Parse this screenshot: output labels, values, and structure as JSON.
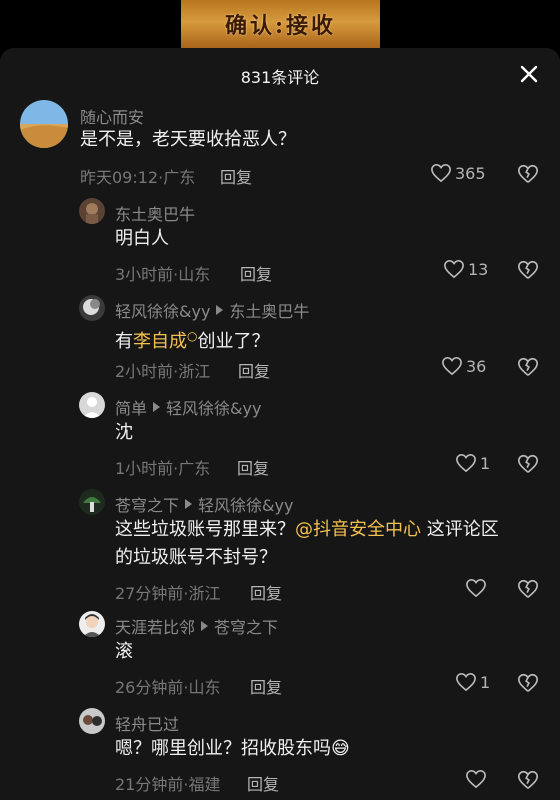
{
  "video": {
    "banner_text": "确认:接收"
  },
  "panel": {
    "title": "831条评论"
  },
  "reply_label": "回复",
  "comments": [
    {
      "user": "随心而安",
      "text": "是不是，老天要收拾恶人？",
      "meta": "昨天09:12·广东",
      "likes": "365"
    },
    {
      "user": "东土奥巴牛",
      "text": "明白人",
      "meta": "3小时前·山东",
      "likes": "13"
    },
    {
      "user": "轻风徐徐&yy",
      "reply_to": "东土奥巴牛",
      "text_before": "有",
      "mention": "李自成",
      "text_after": "创业了？",
      "meta": "2小时前·浙江",
      "likes": "36"
    },
    {
      "user": "简单",
      "reply_to": "轻风徐徐&yy",
      "text": "沈",
      "meta": "1小时前·广东",
      "likes": "1"
    },
    {
      "user": "苍穹之下",
      "reply_to": "轻风徐徐&yy",
      "text_line1_before": "这些垃圾账号那里来？",
      "mention": "@抖音安全中心",
      "text_line1_after": " 这评论区",
      "text_line2": "的垃圾账号不封号？",
      "meta": "27分钟前·浙江",
      "likes": ""
    },
    {
      "user": "天涯若比邻",
      "reply_to": "苍穹之下",
      "text": "滚",
      "meta": "26分钟前·山东",
      "likes": "1"
    },
    {
      "user": "轻舟已过",
      "text": "嗯？哪里创业？招收股东吗",
      "emoji": "😅",
      "meta": "21分钟前·福建",
      "likes": ""
    }
  ]
}
